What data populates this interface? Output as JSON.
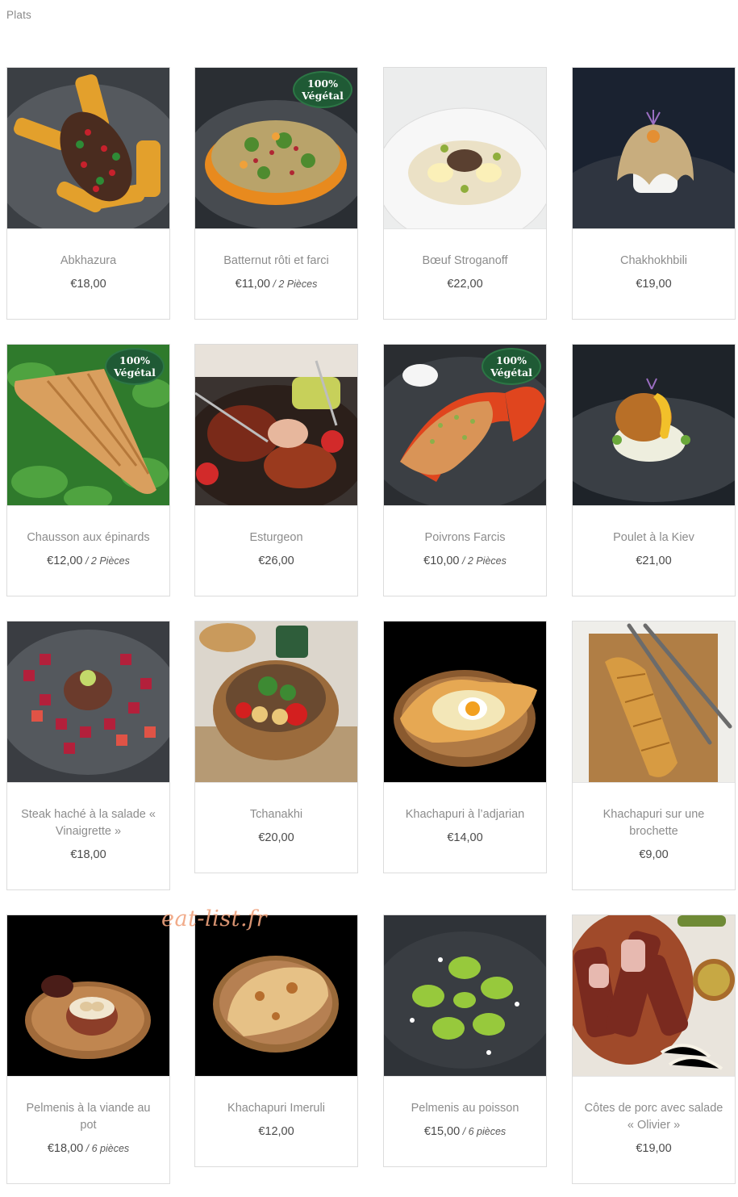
{
  "page": {
    "section_title": "Plats"
  },
  "watermark": "eat-list.fr",
  "badge": {
    "line1": "100%",
    "line2": "Végétal"
  },
  "dishes": [
    {
      "name": "Abkhazura",
      "price": "€18,00",
      "unit": "",
      "icon": "grilled-meat-with-potatoes-image",
      "vegetal": false
    },
    {
      "name": "Batternut rôti et farci",
      "price": "€11,00",
      "unit": "2 Pièces",
      "icon": "stuffed-squash-image",
      "vegetal": true
    },
    {
      "name": "Bœuf Stroganoff",
      "price": "€22,00",
      "unit": "",
      "icon": "beef-stroganoff-bowl-image",
      "vegetal": false
    },
    {
      "name": "Chakhokhbili",
      "price": "€19,00",
      "unit": "",
      "icon": "chicken-stew-rice-image",
      "vegetal": false
    },
    {
      "name": "Chausson aux épinards",
      "price": "€12,00",
      "unit": "2 Pièces",
      "icon": "spinach-pastry-image",
      "vegetal": true
    },
    {
      "name": "Esturgeon",
      "price": "€26,00",
      "unit": "",
      "icon": "grilled-sturgeon-image",
      "vegetal": false
    },
    {
      "name": "Poivrons Farcis",
      "price": "€10,00",
      "unit": "2 Pièces",
      "icon": "stuffed-peppers-image",
      "vegetal": true
    },
    {
      "name": "Poulet à la Kiev",
      "price": "€21,00",
      "unit": "",
      "icon": "chicken-kiev-image",
      "vegetal": false
    },
    {
      "name": "Steak haché à la salade « Vinaigrette »",
      "price": "€18,00",
      "unit": "",
      "icon": "beet-salad-steak-image",
      "vegetal": false
    },
    {
      "name": "Tchanakhi",
      "price": "€20,00",
      "unit": "",
      "icon": "clay-pot-stew-image",
      "vegetal": false
    },
    {
      "name": "Khachapuri à l’adjarian",
      "price": "€14,00",
      "unit": "",
      "icon": "adjarian-khachapuri-image",
      "vegetal": false
    },
    {
      "name": "Khachapuri sur une brochette",
      "price": "€9,00",
      "unit": "",
      "icon": "khachapuri-skewer-image",
      "vegetal": false
    },
    {
      "name": "Pelmenis à la viande au pot",
      "price": "€18,00",
      "unit": "6 pièces",
      "icon": "pelmeni-pot-image",
      "vegetal": false
    },
    {
      "name": "Khachapuri Imeruli",
      "price": "€12,00",
      "unit": "",
      "icon": "imeruli-khachapuri-image",
      "vegetal": false
    },
    {
      "name": "Pelmenis au poisson",
      "price": "€15,00",
      "unit": "6 pièces",
      "icon": "green-fish-pelmeni-image",
      "vegetal": false
    },
    {
      "name": "Côtes de porc avec salade « Olivier »",
      "price": "€19,00",
      "unit": "",
      "icon": "pork-ribs-image",
      "vegetal": false
    }
  ]
}
